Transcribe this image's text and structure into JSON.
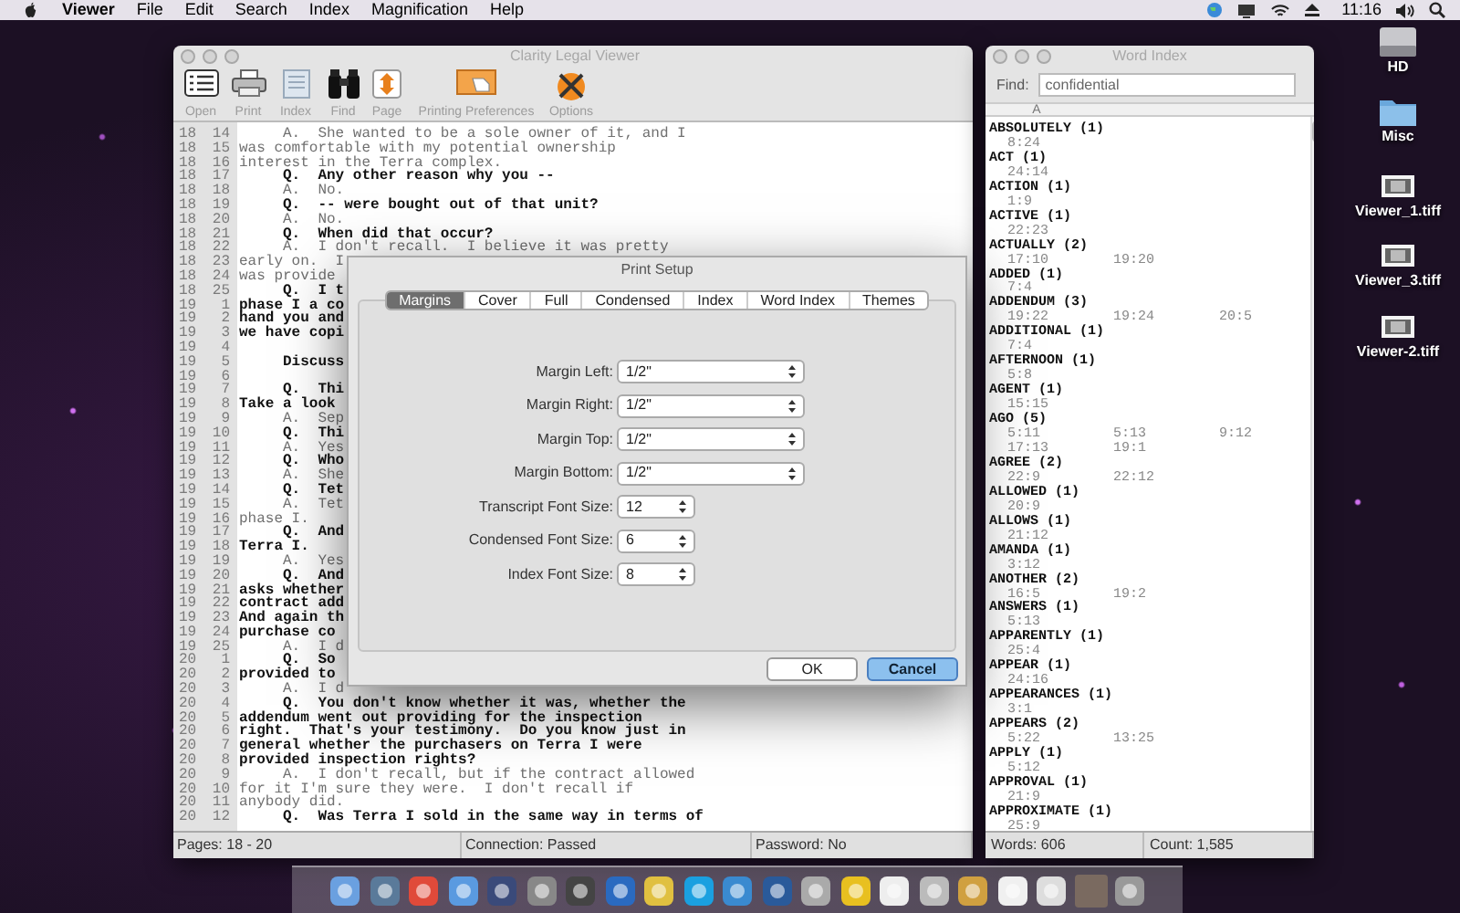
{
  "menu_bar": {
    "app": "Viewer",
    "items": [
      "File",
      "Edit",
      "Search",
      "Index",
      "Magnification",
      "Help"
    ],
    "clock": "11:16"
  },
  "desktop_icons": [
    {
      "label": "HD",
      "kind": "drive"
    },
    {
      "label": "Misc",
      "kind": "folder"
    },
    {
      "label": "Viewer_1.tiff",
      "kind": "image"
    },
    {
      "label": "Viewer_3.tiff",
      "kind": "image"
    },
    {
      "label": "Viewer-2.tiff",
      "kind": "image"
    }
  ],
  "viewer_window": {
    "title": "Clarity Legal Viewer",
    "toolbar": [
      {
        "label": "Open",
        "kind": "open"
      },
      {
        "label": "Print",
        "kind": "print"
      },
      {
        "label": "Index",
        "kind": "index"
      },
      {
        "label": "Find",
        "kind": "find"
      },
      {
        "label": "Page",
        "kind": "page"
      },
      {
        "label": "Printing Preferences",
        "kind": "preferences"
      },
      {
        "label": "Options",
        "kind": "options"
      }
    ],
    "transcript": [
      {
        "page": "18",
        "line": "14",
        "kind": "answer",
        "text": "     A.  She wanted to be a sole owner of it, and I"
      },
      {
        "page": "18",
        "line": "15",
        "kind": "answer",
        "text": "was comfortable with my potential ownership"
      },
      {
        "page": "18",
        "line": "16",
        "kind": "answer",
        "text": "interest in the Terra complex."
      },
      {
        "page": "18",
        "line": "17",
        "kind": "question",
        "text": "     Q.  Any other reason why you --"
      },
      {
        "page": "18",
        "line": "18",
        "kind": "answer",
        "text": "     A.  No."
      },
      {
        "page": "18",
        "line": "19",
        "kind": "question",
        "text": "     Q.  -- were bought out of that unit?"
      },
      {
        "page": "18",
        "line": "20",
        "kind": "answer",
        "text": "     A.  No."
      },
      {
        "page": "18",
        "line": "21",
        "kind": "question",
        "text": "     Q.  When did that occur?"
      },
      {
        "page": "18",
        "line": "22",
        "kind": "answer",
        "text": "     A.  I don't recall.  I believe it was pretty"
      },
      {
        "page": "18",
        "line": "23",
        "kind": "answer",
        "text": "early on.  I"
      },
      {
        "page": "18",
        "line": "24",
        "kind": "answer",
        "text": "was provide"
      },
      {
        "page": "18",
        "line": "25",
        "kind": "question",
        "text": "     Q.  I t"
      },
      {
        "page": "19",
        "line": "1",
        "kind": "question",
        "text": "phase I a co"
      },
      {
        "page": "19",
        "line": "2",
        "kind": "question",
        "text": "hand you and"
      },
      {
        "page": "19",
        "line": "3",
        "kind": "question",
        "text": "we have copi"
      },
      {
        "page": "19",
        "line": "4",
        "kind": "question"
      },
      {
        "page": "19",
        "line": "5",
        "kind": "question",
        "text": "     Discuss"
      },
      {
        "page": "19",
        "line": "6",
        "kind": "question"
      },
      {
        "page": "19",
        "line": "7",
        "kind": "question",
        "text": "     Q.  Thi"
      },
      {
        "page": "19",
        "line": "8",
        "kind": "question",
        "text": "Take a look"
      },
      {
        "page": "19",
        "line": "9",
        "kind": "answer",
        "text": "     A.  Sep"
      },
      {
        "page": "19",
        "line": "10",
        "kind": "question",
        "text": "     Q.  Thi"
      },
      {
        "page": "19",
        "line": "11",
        "kind": "answer",
        "text": "     A.  Yes"
      },
      {
        "page": "19",
        "line": "12",
        "kind": "question",
        "text": "     Q.  Who"
      },
      {
        "page": "19",
        "line": "13",
        "kind": "answer",
        "text": "     A.  She"
      },
      {
        "page": "19",
        "line": "14",
        "kind": "question",
        "text": "     Q.  Tet"
      },
      {
        "page": "19",
        "line": "15",
        "kind": "answer",
        "text": "     A.  Tet"
      },
      {
        "page": "19",
        "line": "16",
        "kind": "answer",
        "text": "phase I."
      },
      {
        "page": "19",
        "line": "17",
        "kind": "question",
        "text": "     Q.  And"
      },
      {
        "page": "19",
        "line": "18",
        "kind": "question",
        "text": "Terra I."
      },
      {
        "page": "19",
        "line": "19",
        "kind": "answer",
        "text": "     A.  Yes"
      },
      {
        "page": "19",
        "line": "20",
        "kind": "question",
        "text": "     Q.  And"
      },
      {
        "page": "19",
        "line": "21",
        "kind": "question",
        "text": "asks whether"
      },
      {
        "page": "19",
        "line": "22",
        "kind": "question",
        "text": "contract add"
      },
      {
        "page": "19",
        "line": "23",
        "kind": "question",
        "text": "And again th"
      },
      {
        "page": "19",
        "line": "24",
        "kind": "question",
        "text": "purchase co"
      },
      {
        "page": "19",
        "line": "25",
        "kind": "answer",
        "text": "     A.  I d"
      },
      {
        "page": "20",
        "line": "1",
        "kind": "question",
        "text": "     Q.  So"
      },
      {
        "page": "20",
        "line": "2",
        "kind": "question",
        "text": "provided to"
      },
      {
        "page": "20",
        "line": "3",
        "kind": "answer",
        "text": "     A.  I d"
      },
      {
        "page": "20",
        "line": "4",
        "kind": "question",
        "text": "     Q.  You don't know whether it was, whether the"
      },
      {
        "page": "20",
        "line": "5",
        "kind": "question",
        "text": "addendum went out providing for the inspection"
      },
      {
        "page": "20",
        "line": "6",
        "kind": "question",
        "text": "right.  That's your testimony.  Do you know just in"
      },
      {
        "page": "20",
        "line": "7",
        "kind": "question",
        "text": "general whether the purchasers on Terra I were"
      },
      {
        "page": "20",
        "line": "8",
        "kind": "question",
        "text": "provided inspection rights?"
      },
      {
        "page": "20",
        "line": "9",
        "kind": "answer",
        "text": "     A.  I don't recall, but if the contract allowed"
      },
      {
        "page": "20",
        "line": "10",
        "kind": "answer",
        "text": "for it I'm sure they were.  I don't recall if"
      },
      {
        "page": "20",
        "line": "11",
        "kind": "answer",
        "text": "anybody did."
      },
      {
        "page": "20",
        "line": "12",
        "kind": "question",
        "text": "     Q.  Was Terra I sold in the same way in terms of"
      }
    ],
    "status_bar": [
      "Pages: 18 - 20",
      "Connection: Passed",
      "Password: No"
    ]
  },
  "print_setup": {
    "title": "Print Setup",
    "tabs": [
      {
        "label": "Margins",
        "selected": true
      },
      {
        "label": "Cover",
        "selected": false
      },
      {
        "label": "Full",
        "selected": false
      },
      {
        "label": "Condensed",
        "selected": false
      },
      {
        "label": "Index",
        "selected": false
      },
      {
        "label": "Word Index",
        "selected": false
      },
      {
        "label": "Themes",
        "selected": false
      }
    ],
    "fields": [
      {
        "label": "Margin Left:",
        "value": "1/2\"",
        "kind": "wide"
      },
      {
        "label": "Margin Right:",
        "value": "1/2\"",
        "kind": "wide"
      },
      {
        "label": "Margin Top:",
        "value": "1/2\"",
        "kind": "wide"
      },
      {
        "label": "Margin Bottom:",
        "value": "1/2\"",
        "kind": "wide"
      },
      {
        "label": "Transcript Font Size:",
        "value": "12",
        "kind": "narrow"
      },
      {
        "label": "Condensed Font Size:",
        "value": "6",
        "kind": "narrow"
      },
      {
        "label": "Index Font Size:",
        "value": "8",
        "kind": "narrow"
      }
    ],
    "buttons": [
      {
        "label": "OK",
        "default": false
      },
      {
        "label": "Cancel",
        "default": true
      }
    ]
  },
  "word_index": {
    "title": "Word Index",
    "find_label": "Find:",
    "find_value": "confidential",
    "column": "A",
    "entries": [
      {
        "heading": "ABSOLUTELY (1)",
        "refs": [
          "8:24"
        ]
      },
      {
        "heading": "ACT (1)",
        "refs": [
          "24:14"
        ]
      },
      {
        "heading": "ACTION (1)",
        "refs": [
          "1:9"
        ]
      },
      {
        "heading": "ACTIVE (1)",
        "refs": [
          "22:23"
        ]
      },
      {
        "heading": "ACTUALLY (2)",
        "refs": [
          "17:10",
          "19:20"
        ]
      },
      {
        "heading": "ADDED (1)",
        "refs": [
          "7:4"
        ]
      },
      {
        "heading": "ADDENDUM (3)",
        "refs": [
          "19:22",
          "19:24",
          "20:5"
        ]
      },
      {
        "heading": "ADDITIONAL (1)",
        "refs": [
          "7:4"
        ]
      },
      {
        "heading": "AFTERNOON (1)",
        "refs": [
          "5:8"
        ]
      },
      {
        "heading": "AGENT (1)",
        "refs": [
          "15:15"
        ]
      },
      {
        "heading": "AGO (5)",
        "refs": [
          "5:11",
          "5:13",
          "9:12",
          "17:13",
          "19:1"
        ]
      },
      {
        "heading": "AGREE (2)",
        "refs": [
          "22:9",
          "22:12"
        ]
      },
      {
        "heading": "ALLOWED (1)",
        "refs": [
          "20:9"
        ]
      },
      {
        "heading": "ALLOWS (1)",
        "refs": [
          "21:12"
        ]
      },
      {
        "heading": "AMANDA (1)",
        "refs": [
          "3:12"
        ]
      },
      {
        "heading": "ANOTHER (2)",
        "refs": [
          "16:5",
          "19:2"
        ]
      },
      {
        "heading": "ANSWERS (1)",
        "refs": [
          "5:13"
        ]
      },
      {
        "heading": "APPARENTLY (1)",
        "refs": [
          "25:4"
        ]
      },
      {
        "heading": "APPEAR (1)",
        "refs": [
          "24:16"
        ]
      },
      {
        "heading": "APPEARANCES (1)",
        "refs": [
          "3:1"
        ]
      },
      {
        "heading": "APPEARS (2)",
        "refs": [
          "5:22",
          "13:25"
        ]
      },
      {
        "heading": "APPLY (1)",
        "refs": [
          "5:12"
        ]
      },
      {
        "heading": "APPROVAL (1)",
        "refs": [
          "21:9"
        ]
      },
      {
        "heading": "APPROXIMATE (1)",
        "refs": [
          "25:9"
        ]
      }
    ],
    "status_bar": [
      "Words: 606",
      "Count: 1,585"
    ]
  }
}
